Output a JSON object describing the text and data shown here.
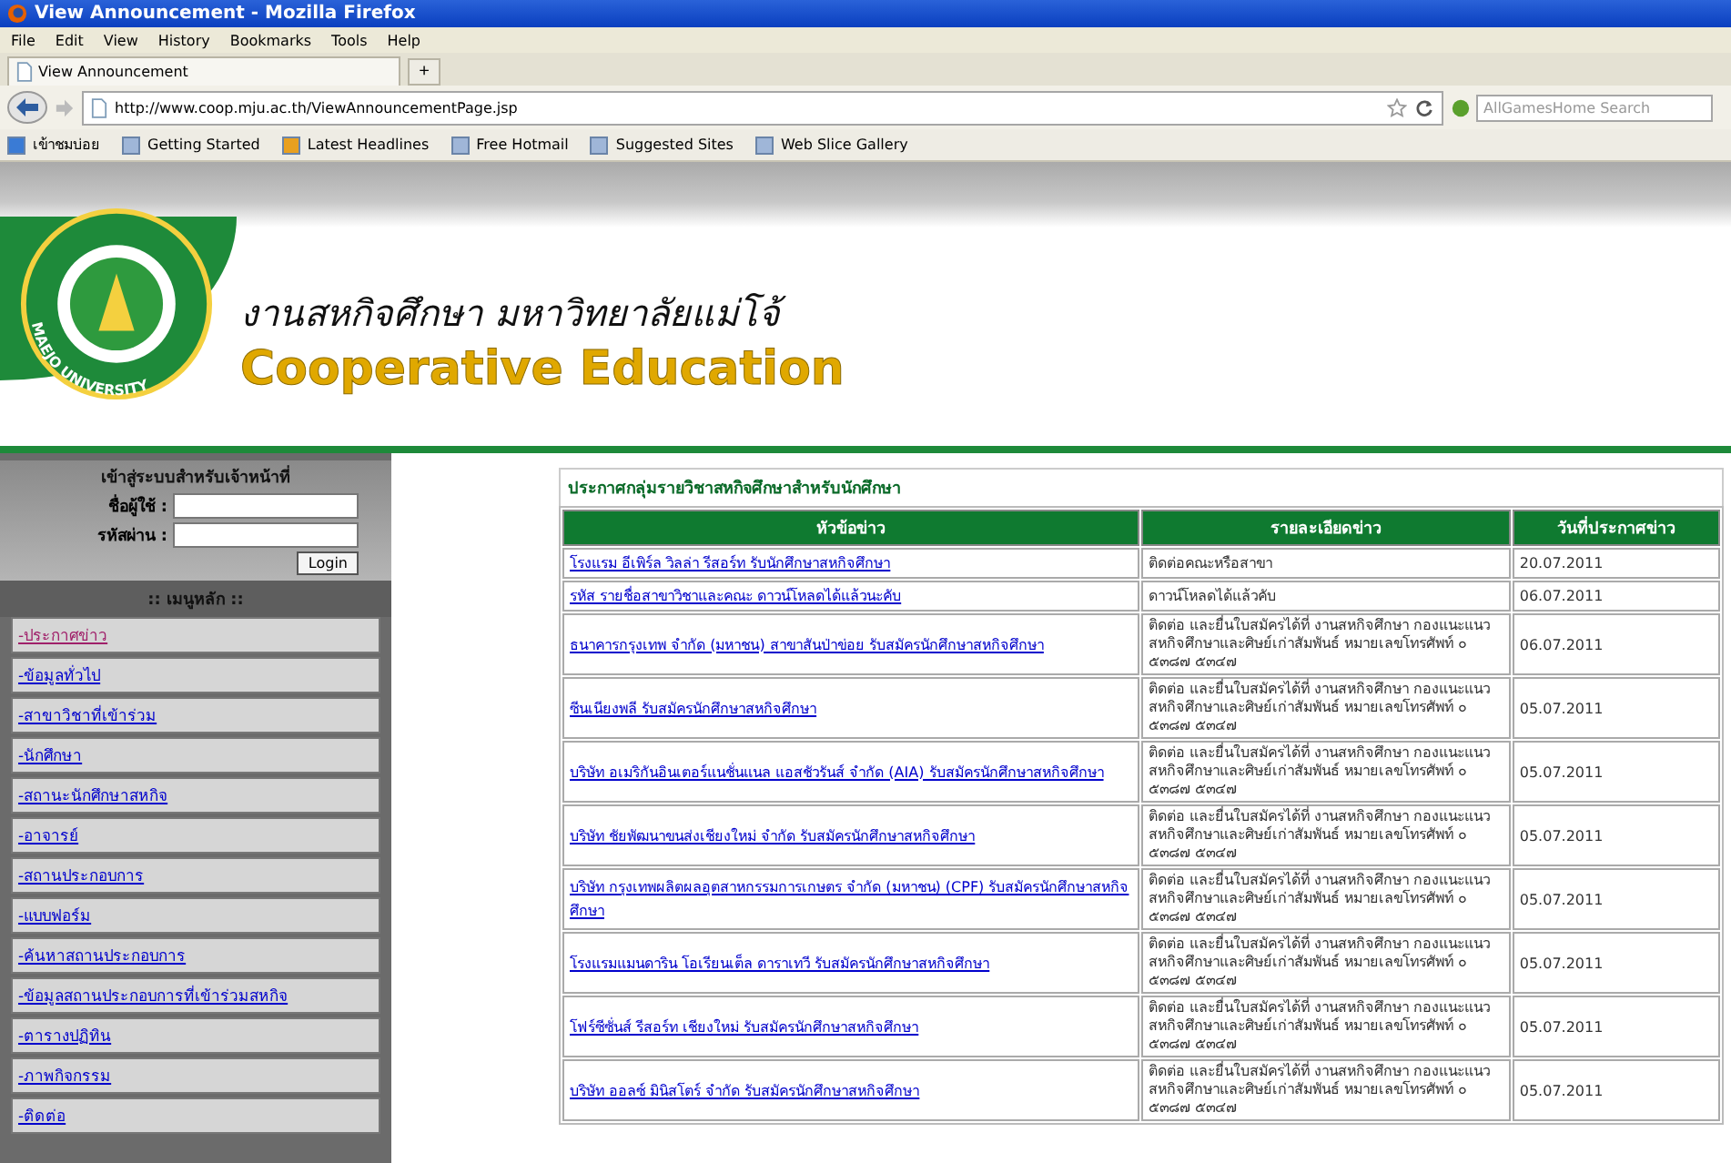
{
  "browser": {
    "title": "View Announcement - Mozilla Firefox",
    "menu": [
      "File",
      "Edit",
      "View",
      "History",
      "Bookmarks",
      "Tools",
      "Help"
    ],
    "tab": {
      "label": "View Announcement"
    },
    "new_tab": "+",
    "url": "http://www.coop.mju.ac.th/ViewAnnouncementPage.jsp",
    "search": {
      "placeholder": "AllGamesHome Search"
    },
    "bookmarks": [
      {
        "label": "เข้าชมบ่อย",
        "kind": "folder"
      },
      {
        "label": "Getting Started",
        "kind": "page"
      },
      {
        "label": "Latest Headlines",
        "kind": "feed"
      },
      {
        "label": "Free Hotmail",
        "kind": "page"
      },
      {
        "label": "Suggested Sites",
        "kind": "page"
      },
      {
        "label": "Web Slice Gallery",
        "kind": "page"
      }
    ]
  },
  "header": {
    "thai_title": "งานสหกิจศึกษา มหาวิทยาลัยแม่โจ้",
    "english_title": "Cooperative Education",
    "seal_text": "MAEJO UNIVERSITY"
  },
  "login": {
    "title": "เข้าสู่ระบบสำหรับเจ้าหน้าที่",
    "username_label": "ชื่อผู้ใช้ :",
    "password_label": "รหัสผ่าน :",
    "button": "Login"
  },
  "menu": {
    "title": ":: เมนูหลัก ::",
    "items": [
      {
        "label": "-ประกาศข่าว",
        "visited": true
      },
      {
        "label": "-ข้อมูลทั่วไป",
        "visited": false
      },
      {
        "label": "-สาขาวิชาที่เข้าร่วม",
        "visited": false
      },
      {
        "label": "-นักศึกษา",
        "visited": false
      },
      {
        "label": "-สถานะนักศึกษาสหกิจ",
        "visited": false
      },
      {
        "label": "-อาจารย์",
        "visited": false
      },
      {
        "label": "-สถานประกอบการ",
        "visited": false
      },
      {
        "label": "-แบบฟอร์ม",
        "visited": false
      },
      {
        "label": "-ค้นหาสถานประกอบการ",
        "visited": false
      },
      {
        "label": "-ข้อมูลสถานประกอบการที่เข้าร่วมสหกิจ",
        "visited": false
      },
      {
        "label": "-ตารางปฏิทิน",
        "visited": false
      },
      {
        "label": "-ภาพกิจกรรม",
        "visited": false
      },
      {
        "label": "-ติดต่อ",
        "visited": false
      }
    ]
  },
  "announcements": {
    "title": "ประกาศกลุ่มรายวิชาสหกิจศึกษาสำหรับนักศึกษา",
    "columns": [
      "หัวข้อข่าว",
      "รายละเอียดข่าว",
      "วันที่ประกาศข่าว"
    ],
    "rows": [
      {
        "headline": "โรงแรม อีเพิร์ล วิลล่า รีสอร์ท รับนักศึกษาสหกิจศึกษา",
        "detail": "ติดต่อคณะหรือสาขา",
        "date": "20.07.2011"
      },
      {
        "headline": "รหัส รายชื่อสาขาวิชาและคณะ ดาวน์โหลดได้แล้วนะคับ",
        "detail": "ดาวน์โหลดได้แล้วคับ",
        "date": "06.07.2011"
      },
      {
        "headline": "ธนาคารกรุงเทพ จำกัด (มหาชน) สาขาสันป่าข่อย รับสมัครนักศึกษาสหกิจศึกษา",
        "detail": "ติดต่อ และยื่นใบสมัครได้ที่ งานสหกิจศึกษา กองแนะแนว สหกิจศึกษาและศิษย์เก่าสัมพันธ์ หมายเลขโทรศัพท์ ๐ ๕๓๘๗ ๕๓๔๗",
        "date": "06.07.2011"
      },
      {
        "headline": "ซีนเนียงพลี รับสมัครนักศึกษาสหกิจศึกษา",
        "detail": "ติดต่อ และยื่นใบสมัครได้ที่ งานสหกิจศึกษา กองแนะแนว สหกิจศึกษาและศิษย์เก่าสัมพันธ์ หมายเลขโทรศัพท์ ๐ ๕๓๘๗ ๕๓๔๗",
        "date": "05.07.2011"
      },
      {
        "headline": "บริษัท อเมริกันอินเตอร์แนชั่นแนล แอสชัวรันส์ จำกัด (AIA) รับสมัครนักศึกษาสหกิจศึกษา",
        "detail": "ติดต่อ และยื่นใบสมัครได้ที่ งานสหกิจศึกษา กองแนะแนว สหกิจศึกษาและศิษย์เก่าสัมพันธ์ หมายเลขโทรศัพท์ ๐ ๕๓๘๗ ๕๓๔๗",
        "date": "05.07.2011"
      },
      {
        "headline": "บริษัท ชัยพัฒนาขนส่งเชียงใหม่ จำกัด รับสมัครนักศึกษาสหกิจศึกษา",
        "detail": "ติดต่อ และยื่นใบสมัครได้ที่ งานสหกิจศึกษา กองแนะแนว สหกิจศึกษาและศิษย์เก่าสัมพันธ์ หมายเลขโทรศัพท์ ๐ ๕๓๘๗ ๕๓๔๗",
        "date": "05.07.2011"
      },
      {
        "headline": "บริษัท กรุงเทพผลิตผลอุตสาหกรรมการเกษตร จำกัด (มหาชน) (CPF) รับสมัครนักศึกษาสหกิจศึกษา",
        "detail": "ติดต่อ และยื่นใบสมัครได้ที่ งานสหกิจศึกษา กองแนะแนว สหกิจศึกษาและศิษย์เก่าสัมพันธ์ หมายเลขโทรศัพท์ ๐ ๕๓๘๗ ๕๓๔๗",
        "date": "05.07.2011"
      },
      {
        "headline": "โรงแรมแมนดาริน โอเรียนเต็ล ดาราเทวี รับสมัครนักศึกษาสหกิจศึกษา",
        "detail": "ติดต่อ และยื่นใบสมัครได้ที่ งานสหกิจศึกษา กองแนะแนว สหกิจศึกษาและศิษย์เก่าสัมพันธ์ หมายเลขโทรศัพท์ ๐ ๕๓๘๗ ๕๓๔๗",
        "date": "05.07.2011"
      },
      {
        "headline": "โฟร์ซีซั่นส์ รีสอร์ท เชียงใหม่ รับสมัครนักศึกษาสหกิจศึกษา",
        "detail": "ติดต่อ และยื่นใบสมัครได้ที่ งานสหกิจศึกษา กองแนะแนว สหกิจศึกษาและศิษย์เก่าสัมพันธ์ หมายเลขโทรศัพท์ ๐ ๕๓๘๗ ๕๓๔๗",
        "date": "05.07.2011"
      },
      {
        "headline": "บริษัท ออลซ์ มินิสโตร์ จำกัด รับสมัครนักศึกษาสหกิจศึกษา",
        "detail": "ติดต่อ และยื่นใบสมัครได้ที่ งานสหกิจศึกษา กองแนะแนว สหกิจศึกษาและศิษย์เก่าสัมพันธ์ หมายเลขโทรศัพท์ ๐ ๕๓๘๗ ๕๓๔๗",
        "date": "05.07.2011"
      }
    ]
  }
}
